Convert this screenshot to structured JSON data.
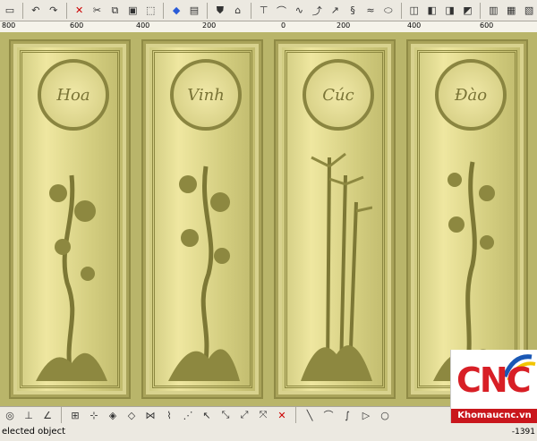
{
  "toolbar": {
    "icons": [
      "new-icon",
      "undo-icon",
      "redo-icon",
      "delete-icon",
      "cut-icon",
      "copy-icon",
      "paste-icon",
      "select-icon",
      "cube-icon",
      "shape-icon",
      "shield-icon",
      "move-icon",
      "node-icon",
      "arc-icon",
      "curve-icon",
      "text-icon",
      "blend-icon",
      "smooth-icon",
      "align-icon",
      "group-icon",
      "mirror-icon",
      "join-icon",
      "weld-icon",
      "trim-icon"
    ]
  },
  "ruler": {
    "labels": [
      "800",
      "600",
      "400",
      "200",
      "0",
      "200",
      "400",
      "600"
    ]
  },
  "panels": [
    {
      "name": "panel-hoa",
      "medallion_text": "Hoa"
    },
    {
      "name": "panel-vinh",
      "medallion_text": "Vinh"
    },
    {
      "name": "panel-cuc",
      "medallion_text": "Cúc"
    },
    {
      "name": "panel-dao",
      "medallion_text": "Đào"
    }
  ],
  "status": {
    "text": "elected object",
    "coord": "-1391"
  },
  "logo": {
    "mark": "CNC",
    "brand": "Khomaucnc.vn",
    "colors": {
      "red": "#d81f26",
      "blue": "#1a58b5",
      "yellow": "#f2c400"
    }
  }
}
